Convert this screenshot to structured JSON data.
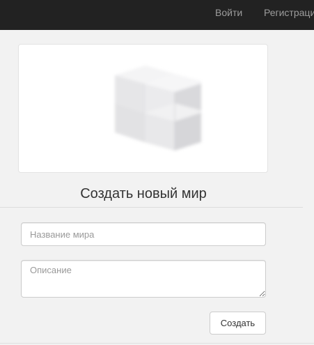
{
  "navbar": {
    "login_label": "Войти",
    "register_label": "Регистрация"
  },
  "image": {
    "icon": "cube-placeholder-icon"
  },
  "form": {
    "title": "Создать новый мир",
    "name_placeholder": "Название мира",
    "name_value": "",
    "description_placeholder": "Описание",
    "description_value": "",
    "submit_label": "Создать"
  },
  "colors": {
    "navbar_bg": "#222222",
    "navbar_link": "#9d9d9d",
    "page_bg": "#f2f2f2",
    "card_bg": "#ffffff"
  }
}
